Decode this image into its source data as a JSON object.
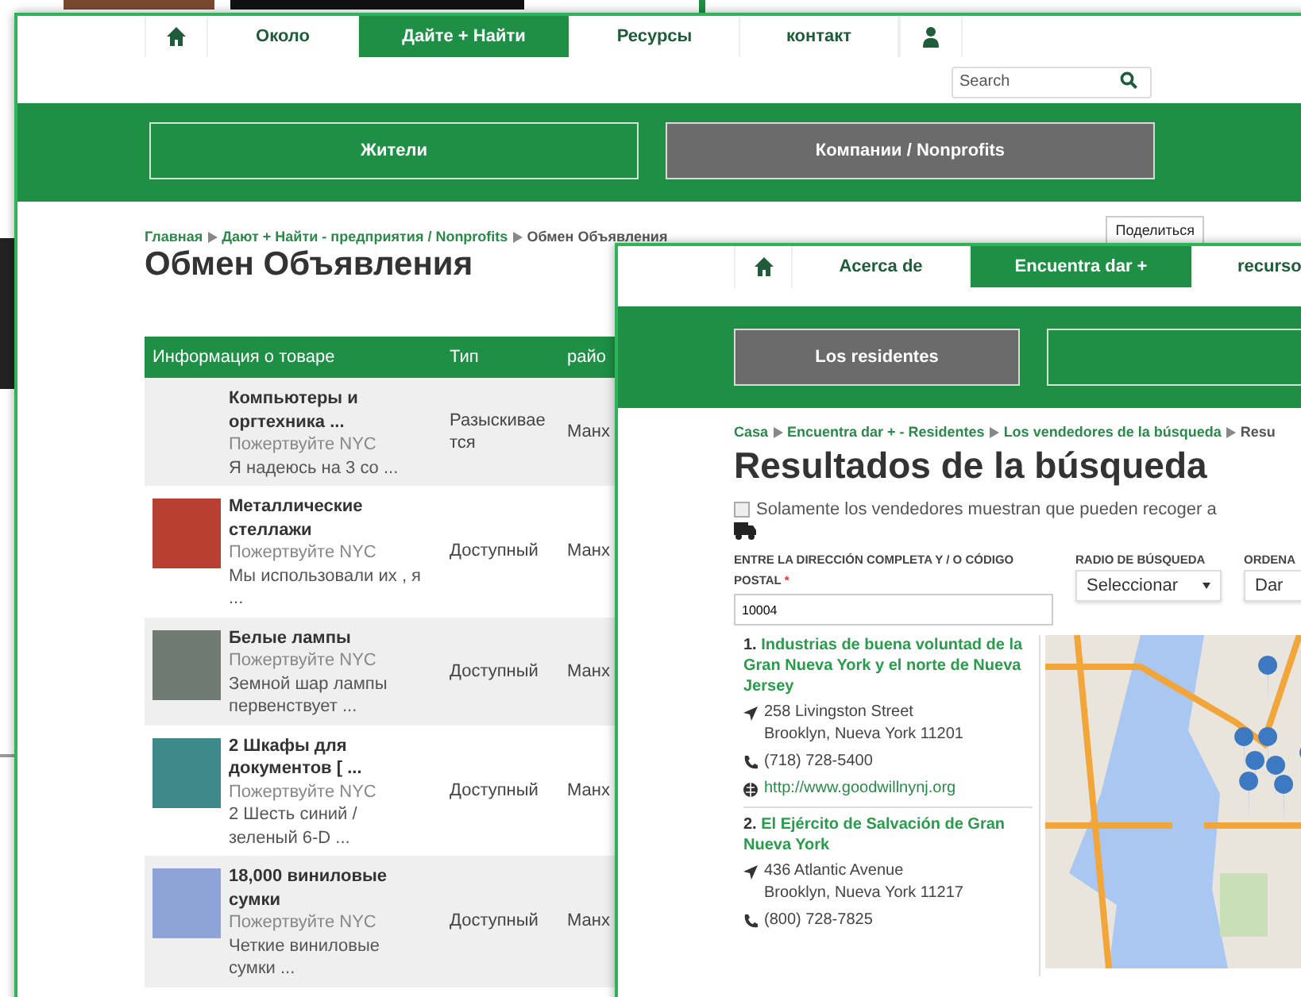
{
  "window_a": {
    "nav": [
      {
        "kind": "home",
        "selected": false
      },
      {
        "kind": "text",
        "label": "Около",
        "selected": false
      },
      {
        "kind": "text",
        "label": "Дайте + Найти",
        "selected": true
      },
      {
        "kind": "text",
        "label": "Ресурсы",
        "selected": false
      },
      {
        "kind": "text",
        "label": "контакт",
        "selected": false
      },
      {
        "kind": "user",
        "selected": false
      }
    ],
    "search": {
      "placeholder": "Search"
    },
    "audience": [
      {
        "label": "Жители",
        "selected": false
      },
      {
        "label": "Компании / Nonprofits",
        "selected": true
      }
    ],
    "breadcrumb": [
      "Главная",
      "Дают + Найти - предприятия / Nonprofits",
      "Обмен Объявления"
    ],
    "share_button": "Поделиться",
    "title": "Обмен Объявления",
    "table": {
      "columns": [
        "Информация о товаре",
        "Тип",
        "райо"
      ],
      "rows": [
        {
          "photo": false,
          "name": "Компьютеры и оргтехника ...",
          "org": "Пожертвуйте NYC",
          "desc": "Я надеюсь на 3 со ...",
          "type": "Разыскивае тся",
          "area": "Манх"
        },
        {
          "photo": true,
          "name": "Металлические стеллажи",
          "org": "Пожертвуйте NYC",
          "desc": "Мы использовали их , я ...",
          "type": "Доступный",
          "area": "Манх"
        },
        {
          "photo": true,
          "name": "Белые лампы",
          "org": "Пожертвуйте NYC",
          "desc": "Земной шар лампы первенствует ...",
          "type": "Доступный",
          "area": "Манх"
        },
        {
          "photo": true,
          "name": "2 Шкафы для документов [ ...",
          "org": "Пожертвуйте NYC",
          "desc": "2 Шесть синий / зеленый 6-D ...",
          "type": "Доступный",
          "area": "Манх"
        },
        {
          "photo": true,
          "name": "18,000 виниловые сумки",
          "org": "Пожертвуйте NYC",
          "desc": "Четкие виниловые сумки ...",
          "type": "Доступный",
          "area": "Манх"
        }
      ]
    }
  },
  "window_b": {
    "nav": [
      {
        "kind": "home",
        "selected": false
      },
      {
        "kind": "text",
        "label": "Acerca de",
        "selected": false
      },
      {
        "kind": "text",
        "label": "Encuentra dar +",
        "selected": true
      },
      {
        "kind": "text",
        "label": "recurso",
        "selected": false
      }
    ],
    "audience": [
      {
        "label": "Los residentes",
        "selected": true
      },
      {
        "selected": false
      }
    ],
    "breadcrumb": [
      "Casa",
      "Encuentra dar + - Residentes",
      "Los vendedores de la búsqueda",
      "Resu"
    ],
    "title": "Resultados de la búsqueda",
    "pickup_filter": {
      "label": "Solamente los vendedores muestran que pueden recoger a",
      "checked": false
    },
    "address_label": "ENTRE LA DIRECCIÓN COMPLETA Y / O CÓDIGO POSTAL",
    "address_required": "*",
    "address_value": "10004",
    "radius_label": "RADIO DE BÚSQUEDA",
    "radius_value": "Seleccionar",
    "order_label": "ORDENA",
    "order_value": "Dar",
    "results": [
      {
        "number": "1.",
        "name": "Industrias de buena voluntad de la Gran Nueva York y el norte de Nueva Jersey",
        "street": "258 Livingston Street",
        "city": "Brooklyn, Nueva York 11201",
        "phone": "(718) 728-5400",
        "web": "http://www.goodwillnynj.org"
      },
      {
        "number": "2.",
        "name": "El Ejército de Salvación de Gran Nueva York",
        "street": "436 Atlantic Avenue",
        "city": "Brooklyn, Nueva York 11217",
        "phone": "(800) 728-7825"
      }
    ]
  }
}
